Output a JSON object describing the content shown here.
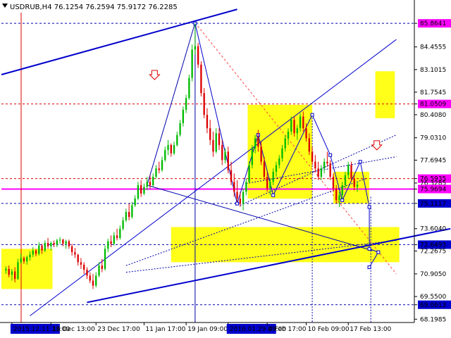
{
  "chart_data": {
    "type": "candlestick",
    "title": "USDRUB,H4  76.1254 76.2594 75.9172 76.2285",
    "symbol": "USDRUB,H4",
    "ohlc_header": [
      "76.1254",
      "76.2594",
      "75.9172",
      "76.2285"
    ],
    "ylim": [
      68.0,
      86.5
    ],
    "y_ticks": [
      {
        "value": 85.8641,
        "label": "85.8641",
        "highlight": "#ff00ff"
      },
      {
        "value": 84.4555,
        "label": "84.4555"
      },
      {
        "value": 83.1015,
        "label": "83.1015"
      },
      {
        "value": 81.7545,
        "label": "81.7545"
      },
      {
        "value": 81.0509,
        "label": "81.0509",
        "highlight": "#ff00ff"
      },
      {
        "value": 80.408,
        "label": "80.4080"
      },
      {
        "value": 79.031,
        "label": "79.0310"
      },
      {
        "value": 77.6945,
        "label": "77.6945"
      },
      {
        "value": 76.5935,
        "label": "76.5935",
        "highlight": "#ff00ff"
      },
      {
        "value": 76.3285,
        "label": "76.3285"
      },
      {
        "value": 75.9694,
        "label": "75.9694",
        "highlight": "#ff00ff"
      },
      {
        "value": 75.1117,
        "label": "75.1117",
        "highlight": "#0000cc"
      },
      {
        "value": 73.604,
        "label": "73.6040"
      },
      {
        "value": 72.6493,
        "label": "72.6493",
        "highlight": "#0000cc"
      },
      {
        "value": 72.2675,
        "label": "72.2675"
      },
      {
        "value": 70.905,
        "label": "70.9050"
      },
      {
        "value": 69.55,
        "label": "69.5500"
      },
      {
        "value": 69.0613,
        "label": "69.0613",
        "highlight": "#0000cc"
      },
      {
        "value": 68.1985,
        "label": "68.1985"
      }
    ],
    "x_ticks": [
      {
        "index": 2,
        "label": "2015.12.11 13:00",
        "highlight": true
      },
      {
        "index": 15,
        "label": "16 Dec 13:00"
      },
      {
        "index": 30,
        "label": "23 Dec 17:00"
      },
      {
        "index": 46,
        "label": "11 Jan 17:00"
      },
      {
        "index": 60,
        "label": "19 Jan 09:00"
      },
      {
        "index": 74,
        "label": "2016.01.29 09:00",
        "highlight": true
      },
      {
        "index": 87,
        "label": "4 Feb 17:00"
      },
      {
        "index": 100,
        "label": "10 Feb 09:00"
      },
      {
        "index": 114,
        "label": "17 Feb 13:00"
      }
    ],
    "x_count": 135,
    "x_extent": [
      -1.5,
      136
    ],
    "bull_color": "#00bb00",
    "bear_color": "#dd0000",
    "candles": [
      [
        71.1,
        71.35,
        70.9,
        71.2
      ],
      [
        71.2,
        71.4,
        70.7,
        70.85
      ],
      [
        70.85,
        71.2,
        70.5,
        71.05
      ],
      [
        71.05,
        71.3,
        70.4,
        70.6
      ],
      [
        70.6,
        71.8,
        70.55,
        71.6
      ],
      [
        71.6,
        72.1,
        71.5,
        71.85
      ],
      [
        71.85,
        71.95,
        71.5,
        71.65
      ],
      [
        71.65,
        72.0,
        71.45,
        71.9
      ],
      [
        71.9,
        72.25,
        71.7,
        72.05
      ],
      [
        72.05,
        72.5,
        71.9,
        72.3
      ],
      [
        72.3,
        72.4,
        71.95,
        72.1
      ],
      [
        72.1,
        72.8,
        72.0,
        72.6
      ],
      [
        72.6,
        72.7,
        72.1,
        72.3
      ],
      [
        72.3,
        72.9,
        72.2,
        72.75
      ],
      [
        72.75,
        73.05,
        72.4,
        72.55
      ],
      [
        72.55,
        72.85,
        72.3,
        72.75
      ],
      [
        72.75,
        72.9,
        72.5,
        72.65
      ],
      [
        72.65,
        73.0,
        72.5,
        72.9
      ],
      [
        72.9,
        73.1,
        72.7,
        72.95
      ],
      [
        72.95,
        73.0,
        72.55,
        72.7
      ],
      [
        72.7,
        72.95,
        72.4,
        72.85
      ],
      [
        72.85,
        72.95,
        72.4,
        72.55
      ],
      [
        72.55,
        72.7,
        72.0,
        72.2
      ],
      [
        72.2,
        72.45,
        71.85,
        72.05
      ],
      [
        72.05,
        72.1,
        71.4,
        71.6
      ],
      [
        71.6,
        71.85,
        71.2,
        71.45
      ],
      [
        71.45,
        71.6,
        70.9,
        71.15
      ],
      [
        71.15,
        71.3,
        70.6,
        70.8
      ],
      [
        70.8,
        71.0,
        70.35,
        70.5
      ],
      [
        70.5,
        70.9,
        70.0,
        70.2
      ],
      [
        70.2,
        71.0,
        70.1,
        70.8
      ],
      [
        70.8,
        71.6,
        70.7,
        71.4
      ],
      [
        71.4,
        71.8,
        71.0,
        71.2
      ],
      [
        71.2,
        72.6,
        71.1,
        72.4
      ],
      [
        72.4,
        73.0,
        72.2,
        72.85
      ],
      [
        72.85,
        73.2,
        72.5,
        72.7
      ],
      [
        72.7,
        73.4,
        72.6,
        73.2
      ],
      [
        73.2,
        73.6,
        72.9,
        73.05
      ],
      [
        73.05,
        73.8,
        72.95,
        73.6
      ],
      [
        73.6,
        74.3,
        73.5,
        74.1
      ],
      [
        74.1,
        74.8,
        74.0,
        74.6
      ],
      [
        74.6,
        75.1,
        74.1,
        74.3
      ],
      [
        74.3,
        75.2,
        74.2,
        75.0
      ],
      [
        75.0,
        75.6,
        74.9,
        75.4
      ],
      [
        75.4,
        76.4,
        75.3,
        76.2
      ],
      [
        76.2,
        76.5,
        75.5,
        75.7
      ],
      [
        75.7,
        76.3,
        75.6,
        76.1
      ],
      [
        76.1,
        76.7,
        75.9,
        76.4
      ],
      [
        76.4,
        76.8,
        76.0,
        76.2
      ],
      [
        76.2,
        76.9,
        76.1,
        76.7
      ],
      [
        76.7,
        77.4,
        76.6,
        77.2
      ],
      [
        77.2,
        77.6,
        76.9,
        77.1
      ],
      [
        77.1,
        77.9,
        77.0,
        77.7
      ],
      [
        77.7,
        78.5,
        77.6,
        78.3
      ],
      [
        78.3,
        78.9,
        78.0,
        78.6
      ],
      [
        78.6,
        78.7,
        77.9,
        78.1
      ],
      [
        78.1,
        78.8,
        78.0,
        78.6
      ],
      [
        78.6,
        79.4,
        78.5,
        79.2
      ],
      [
        79.2,
        80.1,
        79.1,
        79.9
      ],
      [
        79.9,
        80.9,
        79.7,
        80.7
      ],
      [
        80.7,
        81.6,
        80.5,
        81.4
      ],
      [
        81.4,
        82.8,
        81.3,
        82.6
      ],
      [
        82.6,
        84.6,
        82.4,
        84.3
      ],
      [
        84.3,
        85.86,
        84.0,
        84.5
      ],
      [
        84.5,
        84.7,
        83.2,
        83.4
      ],
      [
        83.4,
        83.6,
        81.5,
        81.7
      ],
      [
        81.7,
        82.0,
        80.2,
        80.4
      ],
      [
        80.4,
        80.8,
        79.3,
        79.6
      ],
      [
        79.6,
        80.1,
        78.6,
        78.9
      ],
      [
        78.9,
        79.4,
        77.9,
        78.2
      ],
      [
        78.2,
        79.6,
        78.1,
        79.3
      ],
      [
        79.3,
        79.6,
        78.3,
        78.6
      ],
      [
        78.6,
        78.9,
        77.4,
        77.7
      ],
      [
        77.7,
        78.4,
        77.5,
        78.2
      ],
      [
        78.2,
        78.5,
        76.9,
        77.1
      ],
      [
        77.1,
        77.6,
        76.2,
        76.4
      ],
      [
        76.4,
        76.9,
        75.5,
        75.8
      ],
      [
        75.8,
        76.5,
        75.2,
        75.4
      ],
      [
        75.4,
        75.8,
        74.9,
        75.1
      ],
      [
        75.1,
        76.0,
        74.7,
        75.8
      ],
      [
        75.8,
        76.6,
        75.6,
        76.4
      ],
      [
        76.4,
        77.6,
        76.3,
        77.4
      ],
      [
        77.4,
        78.6,
        77.2,
        78.4
      ],
      [
        78.4,
        79.2,
        78.1,
        79.0
      ],
      [
        79.0,
        79.5,
        78.2,
        78.5
      ],
      [
        78.5,
        78.8,
        77.4,
        77.6
      ],
      [
        77.6,
        77.9,
        76.5,
        76.7
      ],
      [
        76.7,
        77.0,
        75.8,
        76.0
      ],
      [
        76.0,
        76.6,
        75.6,
        76.4
      ],
      [
        76.4,
        77.2,
        76.2,
        77.0
      ],
      [
        77.0,
        77.6,
        76.7,
        77.4
      ],
      [
        77.4,
        78.0,
        77.2,
        77.8
      ],
      [
        77.8,
        78.6,
        77.6,
        78.4
      ],
      [
        78.4,
        79.2,
        78.2,
        79.0
      ],
      [
        79.0,
        79.6,
        78.6,
        79.4
      ],
      [
        79.4,
        80.3,
        79.2,
        80.1
      ],
      [
        80.1,
        80.3,
        79.1,
        79.3
      ],
      [
        79.3,
        79.8,
        78.9,
        79.6
      ],
      [
        79.6,
        80.5,
        79.4,
        80.3
      ],
      [
        80.3,
        80.6,
        79.4,
        79.6
      ],
      [
        79.6,
        79.9,
        78.8,
        79.0
      ],
      [
        79.0,
        79.3,
        78.0,
        78.2
      ],
      [
        78.2,
        78.5,
        77.4,
        77.6
      ],
      [
        77.6,
        78.0,
        77.0,
        77.2
      ],
      [
        77.2,
        77.6,
        76.5,
        76.7
      ],
      [
        76.7,
        77.4,
        76.5,
        77.2
      ],
      [
        77.2,
        77.8,
        76.9,
        77.6
      ],
      [
        77.6,
        78.2,
        77.3,
        77.5
      ],
      [
        77.5,
        77.7,
        76.5,
        76.7
      ],
      [
        76.7,
        76.9,
        75.8,
        76.0
      ],
      [
        76.0,
        76.2,
        75.1,
        75.3
      ],
      [
        75.3,
        75.8,
        74.9,
        75.6
      ],
      [
        75.6,
        76.4,
        75.4,
        76.2
      ],
      [
        76.2,
        77.0,
        76.0,
        76.8
      ],
      [
        76.8,
        77.6,
        76.6,
        77.4
      ],
      [
        77.4,
        77.6,
        76.4,
        76.6
      ],
      [
        76.6,
        76.8,
        75.9,
        76.1
      ],
      [
        76.1,
        76.4,
        75.8,
        76.23
      ]
    ],
    "horizontal_levels": [
      {
        "value": 85.8641,
        "color": "#0000aa"
      },
      {
        "value": 81.0509,
        "color": "#dd0000"
      },
      {
        "value": 76.5935,
        "color": "#dd0000"
      },
      {
        "value": 75.9694,
        "color": "#ff00ff",
        "solid": true
      },
      {
        "value": 75.1117,
        "color": "#0000aa"
      },
      {
        "value": 72.6493,
        "color": "#0000aa"
      },
      {
        "value": 69.0613,
        "color": "#0000aa"
      }
    ]
  }
}
